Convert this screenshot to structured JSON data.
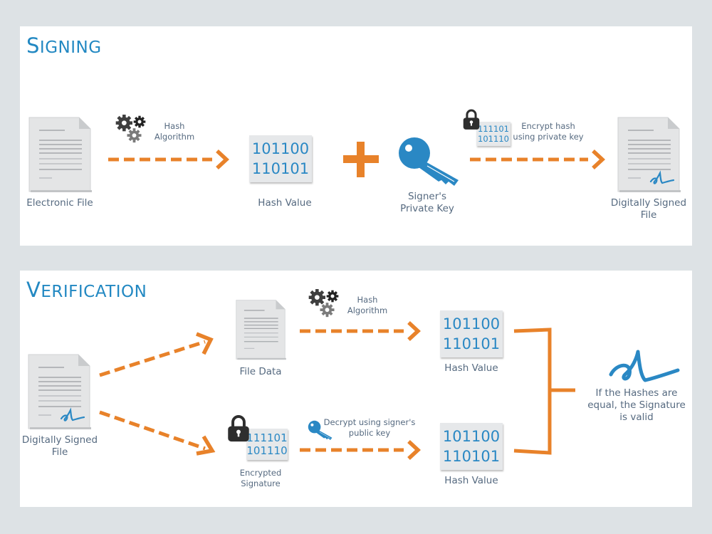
{
  "colors": {
    "background": "#dde2e5",
    "panel": "#ffffff",
    "title": "#2288c2",
    "accent_orange": "#e8822a",
    "key_blue": "#2a88c4",
    "label_text": "#566a80",
    "gear_dark": "#3a3a3a",
    "gear_gray": "#7a7a7a",
    "lock_dark": "#2e2e2e"
  },
  "signing": {
    "title_initial": "S",
    "title_rest": "IGNING",
    "electronic_file_label": "Electronic File",
    "hash_algorithm_label": [
      "Hash",
      "Algorithm"
    ],
    "hash_value": {
      "line1": "101100",
      "line2": "110101",
      "label": "Hash Value"
    },
    "plus_symbol": "+",
    "private_key_label": [
      "Signer's",
      "Private Key"
    ],
    "encrypted_hash": {
      "line1": "111101",
      "line2": "101110"
    },
    "encrypt_label": [
      "Encrypt hash",
      "using private key"
    ],
    "signed_file_label": [
      "Digitally Signed",
      "File"
    ]
  },
  "verification": {
    "title_initial": "V",
    "title_rest": "ERIFICATION",
    "signed_file_label": [
      "Digitally Signed",
      "File"
    ],
    "file_data_label": "File Data",
    "hash_algorithm_label": [
      "Hash",
      "Algorithm"
    ],
    "encrypted_signature": {
      "line1": "111101",
      "line2": "101110",
      "label": [
        "Encrypted",
        "Signature"
      ]
    },
    "decrypt_label": [
      "Decrypt using signer's",
      "public key"
    ],
    "hash_value_top": {
      "line1": "101100",
      "line2": "110101",
      "label": "Hash Value"
    },
    "hash_value_bottom": {
      "line1": "101100",
      "line2": "110101",
      "label": "Hash Value"
    },
    "result_label": [
      "If the Hashes are",
      "equal, the Signature",
      "is valid"
    ]
  },
  "icons": {
    "document": "document-icon",
    "gears": "gears-icon",
    "key": "key-icon",
    "lock": "padlock-icon",
    "signature": "signature-icon",
    "arrow": "dashed-arrow-icon",
    "plus": "plus-icon",
    "bracket": "merge-bracket-icon"
  }
}
